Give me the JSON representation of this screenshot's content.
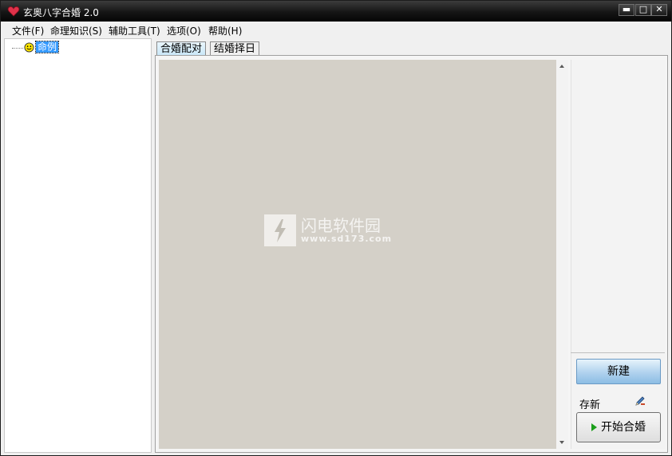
{
  "window": {
    "title": "玄奥八字合婚 2.0",
    "controls": {
      "minimize": "▬",
      "maximize": "□",
      "close": "✕"
    },
    "app_icon": "heart-icon"
  },
  "menu": [
    "文件(F)",
    "命理知识(S)",
    "辅助工具(T)",
    "选项(O)",
    "帮助(H)"
  ],
  "tree": {
    "items": [
      {
        "label": "命例",
        "icon": "smiley-icon",
        "selected": true
      }
    ]
  },
  "tabs": [
    {
      "label": "合婚配对",
      "active": true
    },
    {
      "label": "结婚择日",
      "active": false
    }
  ],
  "side": {
    "new_button": "新建",
    "save_label": "存新",
    "save_icon": "pen-icon",
    "start_button": "开始合婚",
    "start_icon": "play-icon"
  },
  "watermark": {
    "title": "闪电软件园",
    "url": "www.sd173.com"
  },
  "colors": {
    "canvas": "#d4d0c8",
    "selection": "#3399ff",
    "titlebar": "#151515"
  }
}
